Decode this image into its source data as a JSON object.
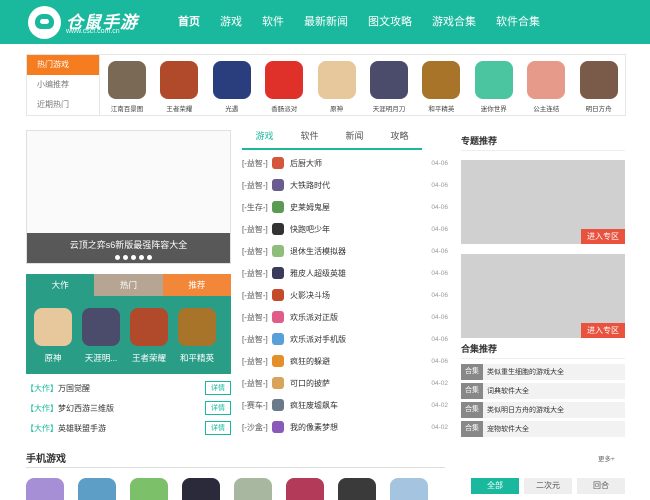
{
  "header": {
    "logo_text": "仓鼠手游",
    "logo_url": "www.cscf.com.cn",
    "nav": [
      "首页",
      "游戏",
      "软件",
      "最新新闻",
      "图文攻略",
      "游戏合集",
      "软件合集"
    ]
  },
  "sidebar_tabs": [
    "热门游戏",
    "小编推荐",
    "近期热门"
  ],
  "top_games": [
    {
      "name": "江南百景图",
      "color": "#7a6a55"
    },
    {
      "name": "王者荣耀",
      "color": "#b04a2a"
    },
    {
      "name": "光遇",
      "color": "#2a3e7e"
    },
    {
      "name": "香肠派对",
      "color": "#e0302a"
    },
    {
      "name": "原神",
      "color": "#e7c79c"
    },
    {
      "name": "天涯明月刀",
      "color": "#4b4c6b"
    },
    {
      "name": "和平精英",
      "color": "#a7742a"
    },
    {
      "name": "迷你世界",
      "color": "#4bc4a0"
    },
    {
      "name": "公主连结",
      "color": "#e59a8a"
    },
    {
      "name": "明日方舟",
      "color": "#7a5a48"
    }
  ],
  "banner": {
    "caption": "云顶之弈s6新版最强阵容大全"
  },
  "rank_tabs": [
    "大作",
    "热门",
    "推荐"
  ],
  "rank_games": [
    {
      "name": "原神",
      "color": "#e7c79c"
    },
    {
      "name": "天涯明...",
      "color": "#4b4c6b"
    },
    {
      "name": "王者荣耀",
      "color": "#b04a2a"
    },
    {
      "name": "和平精英",
      "color": "#a7742a"
    }
  ],
  "left_list": [
    {
      "cat": "【大作】",
      "title": "万国觉醒",
      "btn": "详情"
    },
    {
      "cat": "【大作】",
      "title": "梦幻西游三维版",
      "btn": "详情"
    },
    {
      "cat": "【大作】",
      "title": "英雄联盟手游",
      "btn": "详情"
    }
  ],
  "mid_tabs": [
    "游戏",
    "软件",
    "新闻",
    "攻略"
  ],
  "news": [
    {
      "cat": "[-益智-]",
      "title": "后厨大师",
      "date": "04-06",
      "color": "#d4573c"
    },
    {
      "cat": "[-益智-]",
      "title": "大铁路时代",
      "date": "04-06",
      "color": "#6b5c8e"
    },
    {
      "cat": "[-生存-]",
      "title": "史莱姆鬼屋",
      "date": "04-06",
      "color": "#5a9a52"
    },
    {
      "cat": "[-益智-]",
      "title": "快跑吧少年",
      "date": "04-06",
      "color": "#333333"
    },
    {
      "cat": "[-益智-]",
      "title": "退休生活模拟器",
      "date": "04-06",
      "color": "#8fbe7a"
    },
    {
      "cat": "[-益智-]",
      "title": "雅皮人超级英雄",
      "date": "04-06",
      "color": "#3a3a5a"
    },
    {
      "cat": "[-益智-]",
      "title": "火影决斗场",
      "date": "04-06",
      "color": "#c44a2a"
    },
    {
      "cat": "[-益智-]",
      "title": "欢乐派对正版",
      "date": "04-06",
      "color": "#e05d8a"
    },
    {
      "cat": "[-益智-]",
      "title": "欢乐派对手机版",
      "date": "04-06",
      "color": "#5aa0d8"
    },
    {
      "cat": "[-益智-]",
      "title": "疯狂的躲避",
      "date": "04-06",
      "color": "#e48f2a"
    },
    {
      "cat": "[-益智-]",
      "title": "可口的披萨",
      "date": "04-02",
      "color": "#d8a35a"
    },
    {
      "cat": "[-赛车-]",
      "title": "疯狂废墟飙车",
      "date": "04-02",
      "color": "#6a7a8a"
    },
    {
      "cat": "[-沙盒-]",
      "title": "我的像素梦想",
      "date": "04-02",
      "color": "#8a5ab8"
    }
  ],
  "right": {
    "special_title": "专题推荐",
    "promo_btn": "进入专区",
    "collection_title": "合集推荐",
    "collection_tag": "合集",
    "collections": [
      "类似重生细胞的游戏大全",
      "词典软件大全",
      "类似明日方舟的游戏大全",
      "宠物软件大全"
    ]
  },
  "bottom": {
    "title": "手机游戏",
    "more": "更多+",
    "filters": [
      "全部",
      "二次元",
      "回合"
    ],
    "icons": [
      "#a68fd4",
      "#5c9ec6",
      "#7cc06a",
      "#2a2a3a",
      "#a8b8a0",
      "#b43a5a",
      "#3a3a3a",
      "#a4c4e0"
    ]
  }
}
